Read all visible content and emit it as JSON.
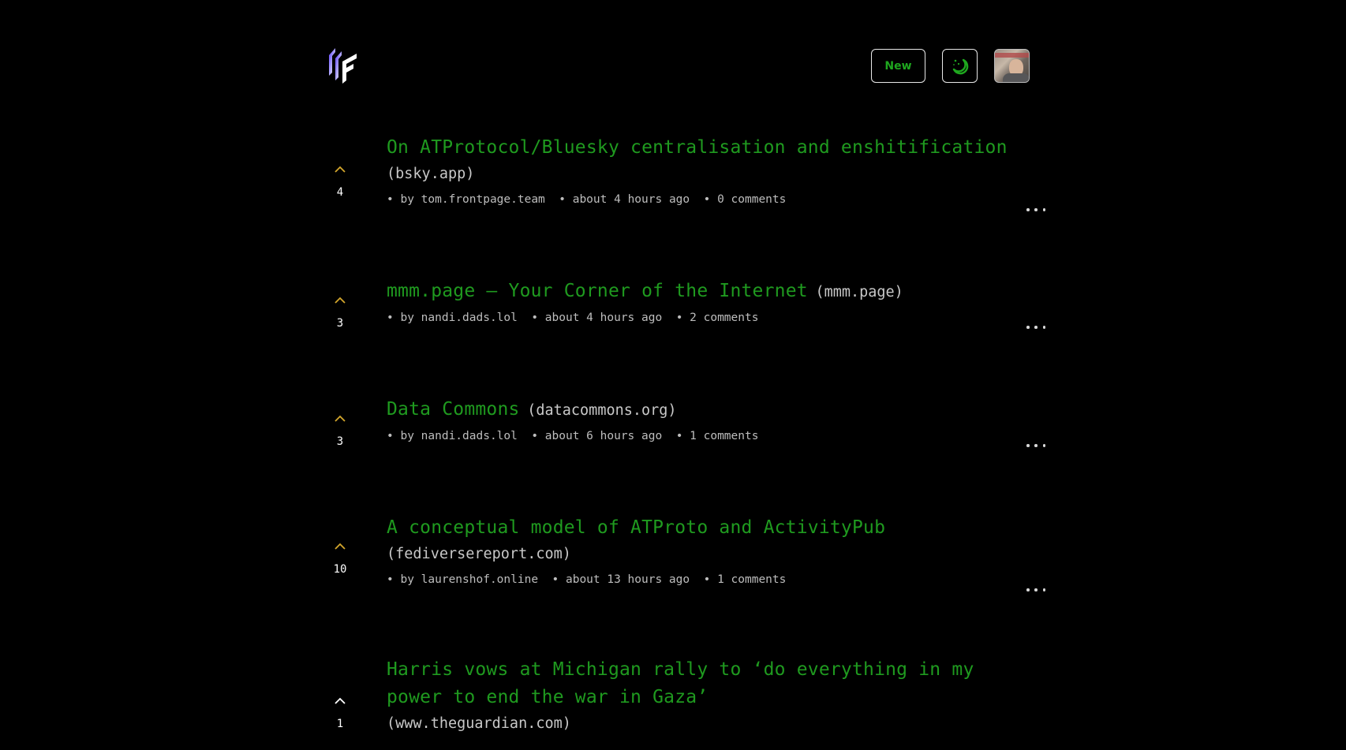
{
  "header": {
    "logo_icon": "frontpage-logo-icon",
    "new_button_label": "New",
    "theme_toggle_icon": "moon-stars-icon",
    "avatar_alt": "user avatar"
  },
  "colors": {
    "background": "#000000",
    "title_green": "#1f9a1f",
    "button_text_green": "#1fa81f",
    "upvote_arrow_active": "#d4a72c",
    "upvote_arrow_default": "#ffffff",
    "meta_text": "#bdbdbd",
    "logo_gradient": [
      "#6a4cff",
      "#ffffff"
    ]
  },
  "posts": [
    {
      "title": "On ATProtocol/Bluesky centralisation and enshitification",
      "domain": "(bsky.app)",
      "votes": "4",
      "author": "• by tom.frontpage.team",
      "time": "• about 4 hours ago",
      "comments": "• 0 comments",
      "upvote_state": "active"
    },
    {
      "title": "mmm.page — Your Corner of the Internet",
      "domain": "(mmm.page)",
      "votes": "3",
      "author": "• by nandi.dads.lol",
      "time": "• about 4 hours ago",
      "comments": "• 2 comments",
      "upvote_state": "active"
    },
    {
      "title": "Data Commons",
      "domain": "(datacommons.org)",
      "votes": "3",
      "author": "• by nandi.dads.lol",
      "time": "• about 6 hours ago",
      "comments": "• 1 comments",
      "upvote_state": "active"
    },
    {
      "title": "A conceptual model of ATProto and ActivityPub",
      "domain": "(fediversereport.com)",
      "votes": "10",
      "author": "• by laurenshof.online",
      "time": "• about 13 hours ago",
      "comments": "• 1 comments",
      "upvote_state": "active"
    },
    {
      "title": "Harris vows at Michigan rally to ‘do everything in my power to end the war in Gaza’",
      "domain": "(www.theguardian.com)",
      "votes": "1",
      "upvote_state": "default"
    }
  ]
}
